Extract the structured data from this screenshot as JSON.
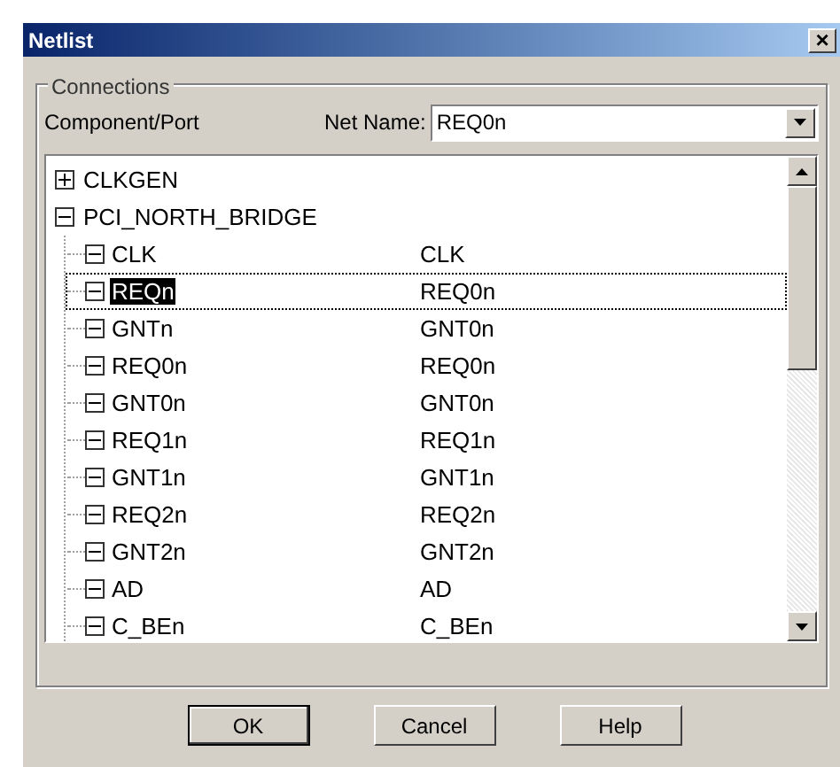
{
  "window": {
    "title": "Netlist",
    "close": "×"
  },
  "group": {
    "title": "Connections"
  },
  "column_label": "Component/Port",
  "net_name": {
    "label": "Net Name:",
    "value": "REQ0n"
  },
  "tree": [
    {
      "label": "CLKGEN",
      "expanded": false,
      "selected": false
    },
    {
      "label": "PCI_NORTH_BRIDGE",
      "expanded": true,
      "selected": false,
      "children": [
        {
          "label": "CLK",
          "net": "CLK",
          "expanded": true,
          "selected": false
        },
        {
          "label": "REQn",
          "net": "REQ0n",
          "expanded": true,
          "selected": true
        },
        {
          "label": "GNTn",
          "net": "GNT0n",
          "expanded": true,
          "selected": false
        },
        {
          "label": "REQ0n",
          "net": "REQ0n",
          "expanded": true,
          "selected": false
        },
        {
          "label": "GNT0n",
          "net": "GNT0n",
          "expanded": true,
          "selected": false
        },
        {
          "label": "REQ1n",
          "net": "REQ1n",
          "expanded": true,
          "selected": false
        },
        {
          "label": "GNT1n",
          "net": "GNT1n",
          "expanded": true,
          "selected": false
        },
        {
          "label": "REQ2n",
          "net": "REQ2n",
          "expanded": true,
          "selected": false
        },
        {
          "label": "GNT2n",
          "net": "GNT2n",
          "expanded": true,
          "selected": false
        },
        {
          "label": "AD",
          "net": "AD",
          "expanded": true,
          "selected": false
        },
        {
          "label": "C_BEn",
          "net": "C_BEn",
          "expanded": true,
          "selected": false
        }
      ]
    }
  ],
  "buttons": [
    "OK",
    "Cancel",
    "Help"
  ]
}
